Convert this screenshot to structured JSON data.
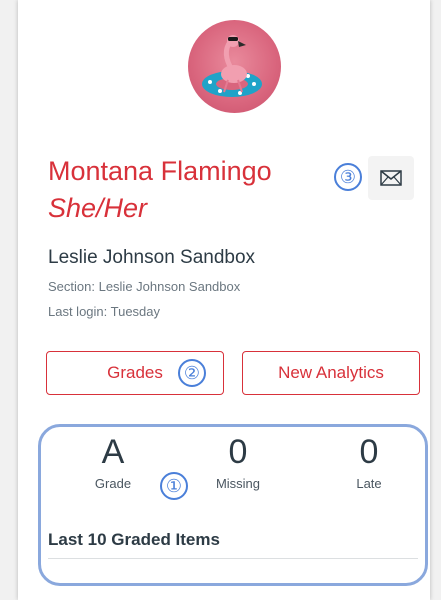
{
  "student": {
    "name": "Montana Flamingo",
    "pronouns": "She/Her",
    "course": "Leslie Johnson Sandbox",
    "section": "Section: Leslie Johnson Sandbox",
    "last_login": "Last login: Tuesday"
  },
  "callouts": {
    "one": "①",
    "two": "②",
    "three": "③"
  },
  "buttons": {
    "grades": "Grades",
    "analytics": "New Analytics"
  },
  "stats": [
    {
      "value": "A",
      "label": "Grade"
    },
    {
      "value": "0",
      "label": "Missing"
    },
    {
      "value": "0",
      "label": "Late"
    }
  ],
  "last_graded": {
    "title": "Last 10 Graded Items"
  },
  "colors": {
    "accent": "#d8313a",
    "callout": "#4a7fd9",
    "highlight": "#8aa8dd",
    "text": "#2d3b45"
  },
  "icons": {
    "avatar": "flamingo-avatar",
    "message": "envelope-icon"
  }
}
